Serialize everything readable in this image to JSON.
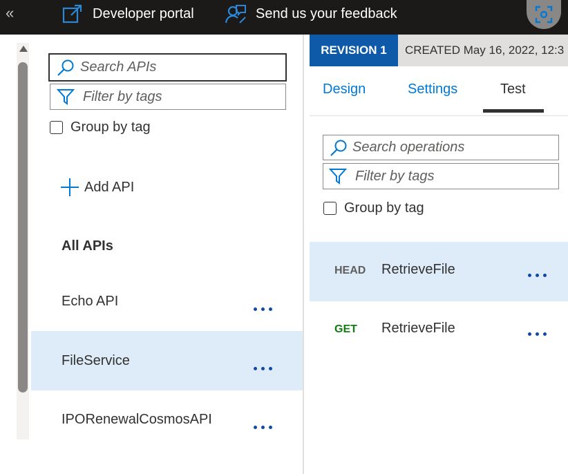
{
  "topbar": {
    "collapse_glyph": "«",
    "developer_portal": "Developer portal",
    "feedback": "Send us your feedback",
    "icons": [
      "double-chevron-left-icon",
      "open-external-icon",
      "feedback-person-icon",
      "screenshot-focus-icon"
    ]
  },
  "left_panel": {
    "search_placeholder": "Search APIs",
    "filter_placeholder": "Filter by tags",
    "group_by_tag": "Group by tag",
    "add_api": "Add API",
    "all_apis": "All APIs",
    "apis": [
      {
        "name": "Echo API",
        "selected": false
      },
      {
        "name": "FileService",
        "selected": true
      },
      {
        "name": "IPORenewalCosmosAPI",
        "selected": false
      }
    ]
  },
  "right_panel": {
    "revision_label": "REVISION 1",
    "created_text": "CREATED May 16, 2022, 12:3",
    "tabs": [
      {
        "label": "Design",
        "active": false
      },
      {
        "label": "Settings",
        "active": false
      },
      {
        "label": "Test",
        "active": true
      }
    ],
    "search_placeholder": "Search operations",
    "filter_placeholder": "Filter by tags",
    "group_by_tag": "Group by tag",
    "operations": [
      {
        "method": "HEAD",
        "name": "RetrieveFile",
        "selected": true
      },
      {
        "method": "GET",
        "name": "RetrieveFile",
        "selected": false
      }
    ]
  },
  "colors": {
    "topbar_bg": "#1b1a19",
    "accent": "#0078d4",
    "revision_badge": "#0f5aa8",
    "selected_row": "#deecf9",
    "get_method": "#107c10"
  }
}
